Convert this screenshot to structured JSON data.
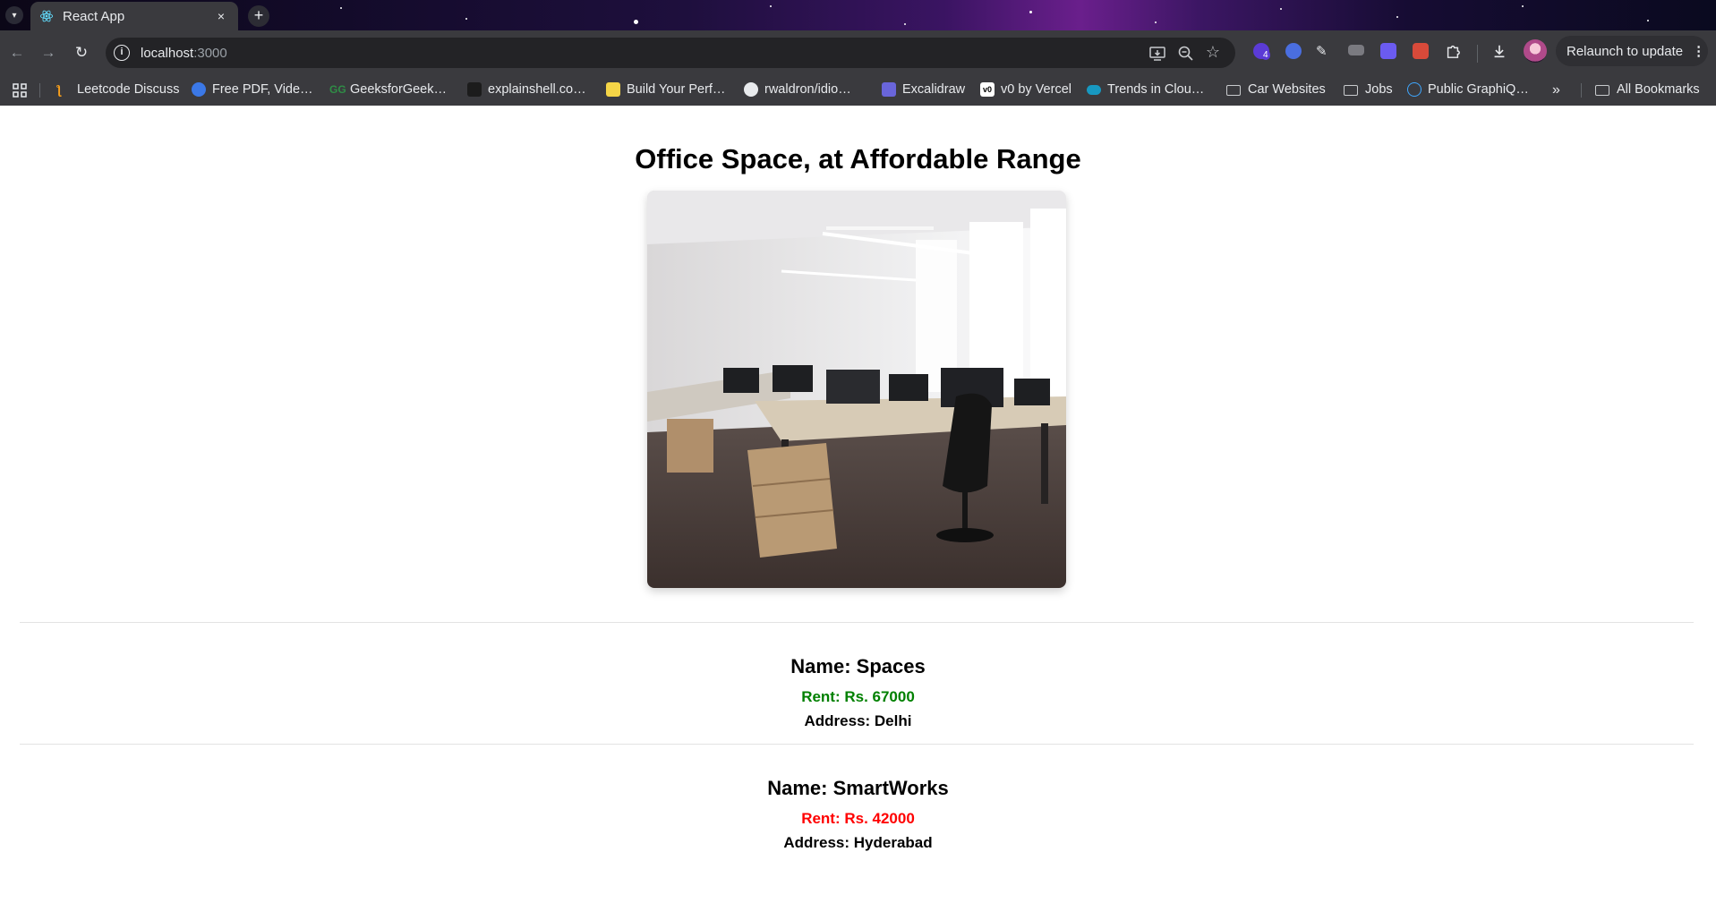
{
  "browser": {
    "tab": {
      "title": "React App",
      "close_glyph": "×"
    },
    "new_tab_glyph": "+",
    "url": {
      "host": "localhost",
      "port": ":3000"
    },
    "relaunch_label": "Relaunch to update",
    "extension_badge": "4",
    "bookmarks": [
      {
        "label": "Leetcode Discuss",
        "icon": "leetcode-icon"
      },
      {
        "label": "Free PDF, Vide…",
        "icon": "pdf-site-icon"
      },
      {
        "label": "GeeksforGeek…",
        "icon": "geeksforgeeks-icon"
      },
      {
        "label": "explainshell.co…",
        "icon": "explainshell-icon"
      },
      {
        "label": "Build Your Perf…",
        "icon": "build-icon"
      },
      {
        "label": "rwaldron/idio…",
        "icon": "github-icon"
      },
      {
        "label": "Excalidraw",
        "icon": "excalidraw-icon"
      },
      {
        "label": "v0 by Vercel",
        "icon": "v0-icon"
      },
      {
        "label": "Trends in Clou…",
        "icon": "salesforce-icon"
      },
      {
        "label": "Car Websites",
        "icon": "folder-icon"
      },
      {
        "label": "Jobs",
        "icon": "folder-icon"
      },
      {
        "label": "Public GraphiQ…",
        "icon": "graphiql-icon"
      }
    ],
    "overflow_glyph": "»",
    "all_bookmarks_label": "All Bookmarks"
  },
  "page": {
    "title": "Office Space, at Affordable Range",
    "listings": [
      {
        "name": "Name: Spaces",
        "rent": "Rent: Rs. 67000",
        "address": "Address: Delhi",
        "rent_color": "#008000"
      },
      {
        "name": "Name: SmartWorks",
        "rent": "Rent: Rs. 42000",
        "address": "Address: Hyderabad",
        "rent_color": "#ff0000"
      }
    ]
  }
}
